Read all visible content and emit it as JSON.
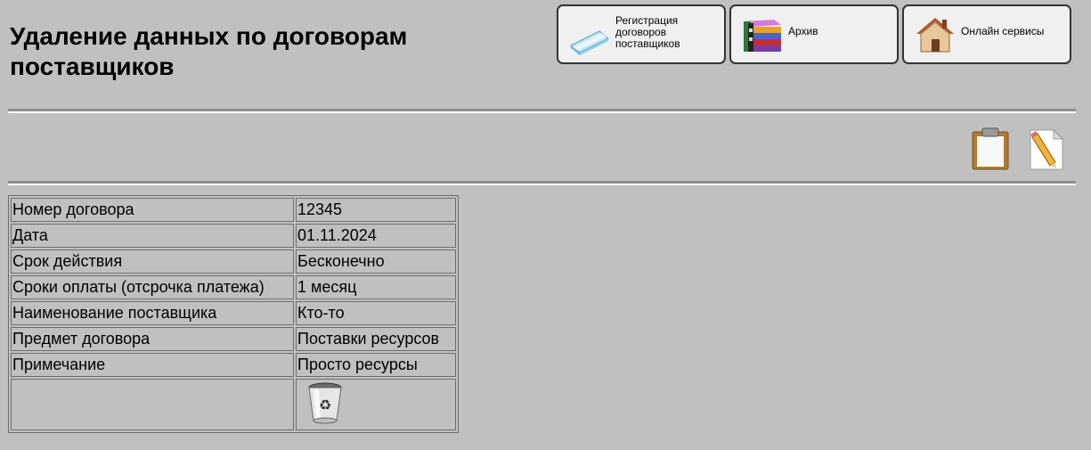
{
  "page": {
    "title": "Удаление данных по договорам поставщиков"
  },
  "nav": [
    {
      "label": "Регистрация договоров поставщиков",
      "icon": "contract-registration-icon"
    },
    {
      "label": "Архив",
      "icon": "archive-books-icon"
    },
    {
      "label": "Онлайн сервисы",
      "icon": "house-icon"
    }
  ],
  "toolbar": {
    "icons": [
      "clipboard-icon",
      "edit-document-icon"
    ]
  },
  "contract": {
    "rows": [
      {
        "label": "Номер договора",
        "value": "12345"
      },
      {
        "label": "Дата",
        "value": "01.11.2024"
      },
      {
        "label": "Срок действия",
        "value": "Бесконечно"
      },
      {
        "label": "Сроки оплаты (отсрочка платежа)",
        "value": "1 месяц"
      },
      {
        "label": "Наименование поставщика",
        "value": "Кто-то"
      },
      {
        "label": "Предмет договора",
        "value": "Поставки ресурсов"
      },
      {
        "label": "Примечание",
        "value": "Просто ресурсы"
      }
    ],
    "delete_icon": "recycle-bin-icon"
  },
  "colors": {
    "background": "#c0c0c0",
    "button_bg": "#f0f0f0",
    "border": "#6e6e6e"
  }
}
